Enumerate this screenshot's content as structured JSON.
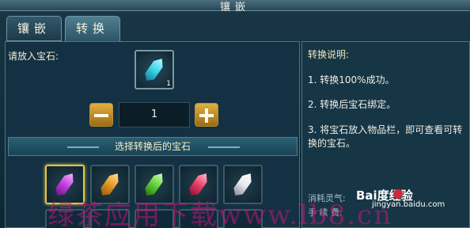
{
  "window": {
    "title": "镶嵌"
  },
  "tabs": [
    {
      "label": "镶嵌",
      "active": false
    },
    {
      "label": "转换",
      "active": true
    }
  ],
  "left": {
    "prompt": "请放入宝石:",
    "slot_qty": "1",
    "quantity": "1",
    "choose_header": "选择转换后的宝石",
    "gems": [
      {
        "icon": "purple-crystal-icon",
        "color": "#c63fe0",
        "selected": true
      },
      {
        "icon": "orange-crystal-icon",
        "color": "#e59a25",
        "selected": false
      },
      {
        "icon": "green-crystal-icon",
        "color": "#5fd23a",
        "selected": false
      },
      {
        "icon": "pink-crystal-icon",
        "color": "#ea3f6b",
        "selected": false
      },
      {
        "icon": "white-crystal-icon",
        "color": "#e8e8ee",
        "selected": false
      }
    ],
    "source_gem": {
      "icon": "cyan-crystal-icon",
      "color": "#3ed7e8"
    }
  },
  "right": {
    "title": "转换说明:",
    "notes": [
      "1. 转换100%成功。",
      "2. 转换后宝石绑定。",
      "3. 将宝石放入物品栏，即可查看可转换的宝石。"
    ],
    "cost_label": "消耗灵气:",
    "fee_label": "手 续 费:"
  },
  "overlay": {
    "watermark": "绿茶应用下载www.lb8.cn",
    "baidu_logo": "Bai度经验",
    "baidu_url": "jingyan.baidu.com"
  }
}
